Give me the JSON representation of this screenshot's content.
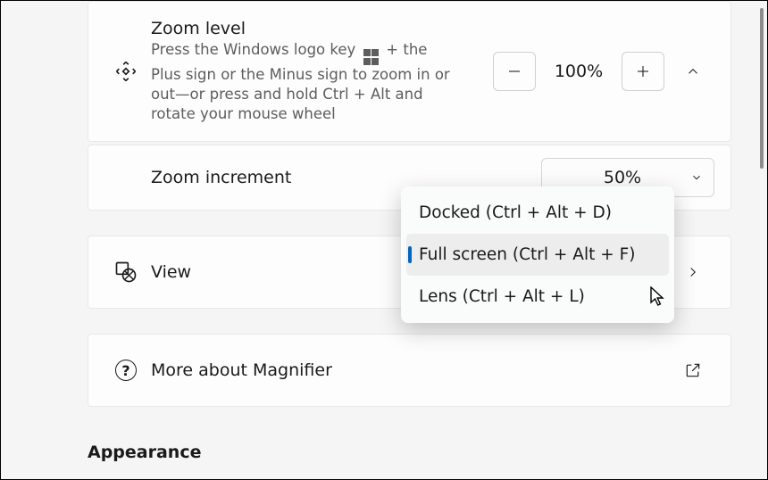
{
  "zoom": {
    "title": "Zoom level",
    "desc_pre": "Press the Windows logo key",
    "desc_post": "+ the Plus sign or the Minus sign to zoom in or out—or press and hold Ctrl + Alt and rotate your mouse wheel",
    "value": "100%"
  },
  "increment": {
    "title": "Zoom increment",
    "selected": "50%"
  },
  "view": {
    "title": "View",
    "options": [
      "Docked (Ctrl + Alt + D)",
      "Full screen (Ctrl + Alt + F)",
      "Lens (Ctrl + Alt + L)"
    ],
    "selected_index": 1
  },
  "help": {
    "title": "More about Magnifier"
  },
  "section": "Appearance"
}
